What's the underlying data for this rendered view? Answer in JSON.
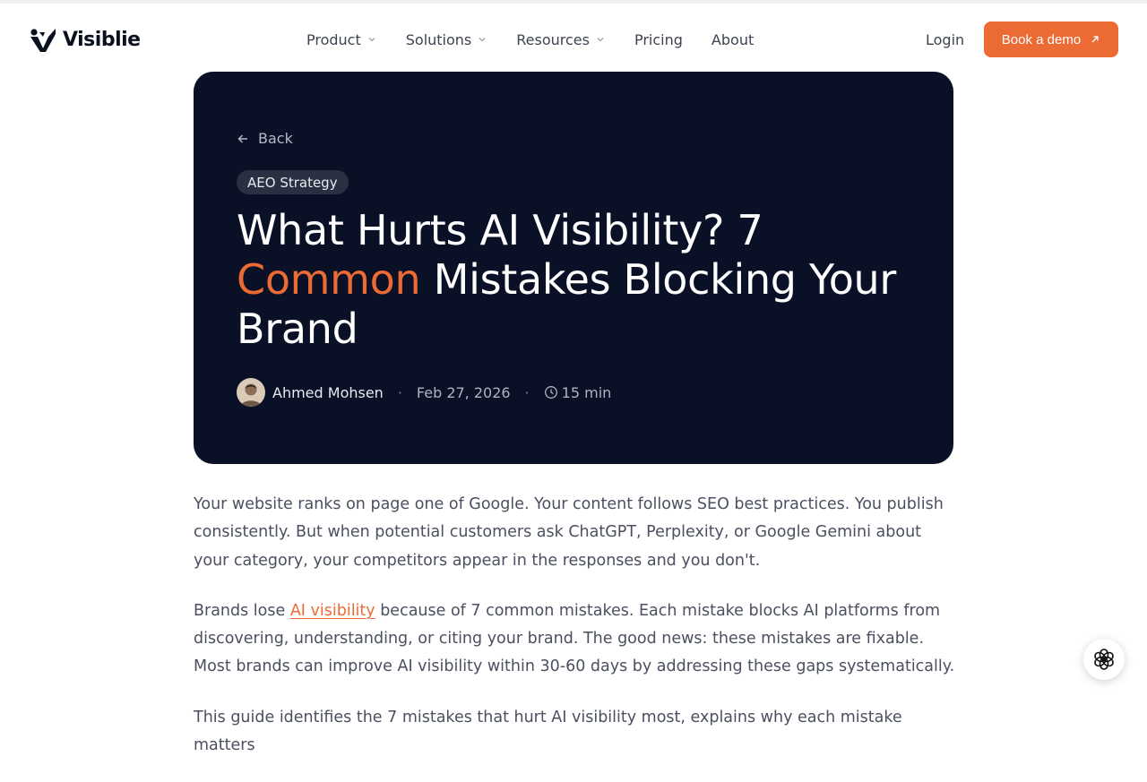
{
  "brand": {
    "name": "Visiblie"
  },
  "nav": {
    "items": [
      {
        "label": "Product",
        "dropdown": true
      },
      {
        "label": "Solutions",
        "dropdown": true
      },
      {
        "label": "Resources",
        "dropdown": true
      },
      {
        "label": "Pricing",
        "dropdown": false
      },
      {
        "label": "About",
        "dropdown": false
      }
    ],
    "login": "Login",
    "cta": "Book a demo"
  },
  "hero": {
    "back": "Back",
    "tag": "AEO Strategy",
    "title_part1": "What Hurts AI Visibility? 7 ",
    "title_accent": "Common",
    "title_part2": " Mistakes Blocking Your Brand",
    "author": "Ahmed Mohsen",
    "separator": "·",
    "date": "Feb 27, 2026",
    "read_time": "15 min"
  },
  "article": {
    "p1": "Your website ranks on page one of Google. Your content follows SEO best practices. You publish consistently. But when potential customers ask ChatGPT, Perplexity, or Google Gemini about your category, your competitors appear in the responses and you don't.",
    "p2_before": "Brands lose ",
    "p2_link": "AI visibility",
    "p2_after": " because of 7 common mistakes. Each mistake blocks AI platforms from discovering, understanding, or citing your brand. The good news: these mistakes are fixable. Most brands can improve AI visibility within 30-60 days by addressing these gaps systematically.",
    "p3": "This guide identifies the 7 mistakes that hurt AI visibility most, explains why each mistake matters"
  },
  "colors": {
    "accent": "#ec6b35",
    "hero_bg": "#0a1026",
    "text_muted": "#4b5060"
  },
  "icons": {
    "logo": "visiblie-logo-mark",
    "chevron": "chevron-down-icon",
    "arrow_out": "arrow-up-right-icon",
    "back": "arrow-left-icon",
    "clock": "clock-icon",
    "chat": "openai-chat-icon"
  }
}
